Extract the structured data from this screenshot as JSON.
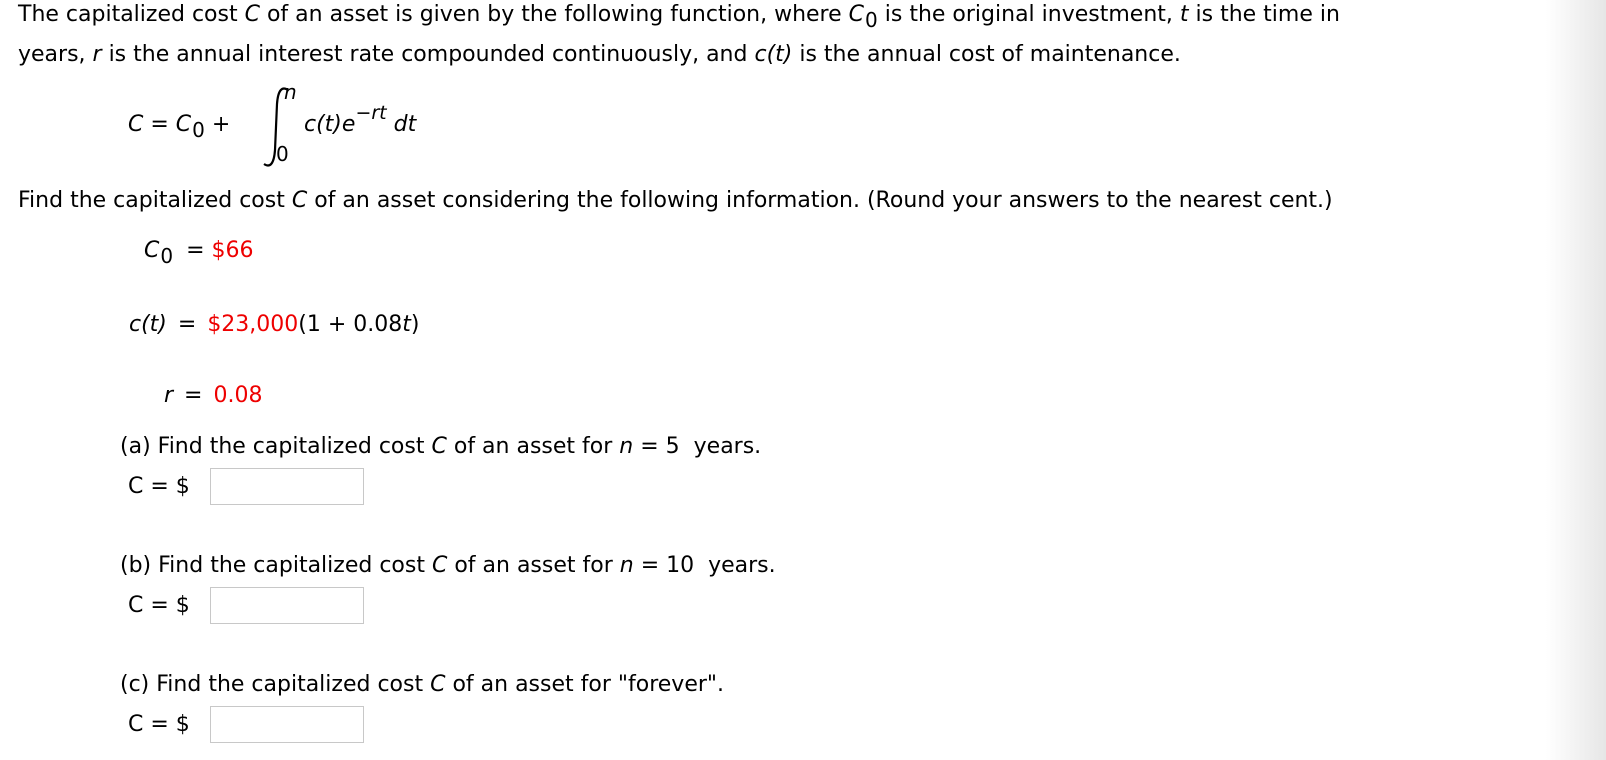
{
  "intro": {
    "line1_a": "The capitalized cost ",
    "C": "C",
    "line1_b": " of an asset is given by the following function, where ",
    "C0_base": "C",
    "C0_sub": "0",
    "line1_c": " is the original investment, ",
    "t": "t",
    "line1_d": " is the time in",
    "line2_a": "years, ",
    "r": "r",
    "line2_b": " is the annual interest rate compounded continuously, and ",
    "ct": "c(t)",
    "line2_c": " is the annual cost of maintenance."
  },
  "formula": {
    "lhs": "C = ",
    "C0_base": "C",
    "C0_sub": "0",
    "plus": " +",
    "upper": "n",
    "lower": "0",
    "integrand": "c(t)e",
    "exponent": "−rt",
    "dt": " dt"
  },
  "instruction": {
    "a": "Find the capitalized cost ",
    "C": "C",
    "b": " of an asset considering the following information. (Round your answers to the nearest cent.)"
  },
  "givens": {
    "C0": {
      "base": "C",
      "sub": "0",
      "eq": " = ",
      "value": "$66"
    },
    "ct": {
      "label": "c(t)",
      "eq": " = ",
      "value": "$23,000",
      "rest_a": "(1 + 0.08",
      "rest_t": "t",
      "rest_b": ")"
    },
    "r": {
      "label": "r",
      "eq": " = ",
      "value": "0.08"
    }
  },
  "parts": [
    {
      "prefix": "(a) Find the capitalized cost ",
      "C": "C",
      "mid": " of an asset for ",
      "n": "n",
      "tail": " = 5  years.",
      "answer_label": "C = $",
      "answer_value": ""
    },
    {
      "prefix": "(b) Find the capitalized cost ",
      "C": "C",
      "mid": " of an asset for ",
      "n": "n",
      "tail": " = 10  years.",
      "answer_label": "C = $",
      "answer_value": ""
    },
    {
      "prefix": "(c) Find the capitalized cost ",
      "C": "C",
      "mid": " of an asset for \"forever\".",
      "n": "",
      "tail": "",
      "answer_label": "C = $",
      "answer_value": ""
    }
  ],
  "colors": {
    "given_value": "#ee0000",
    "input_border": "#c8c8c8"
  }
}
